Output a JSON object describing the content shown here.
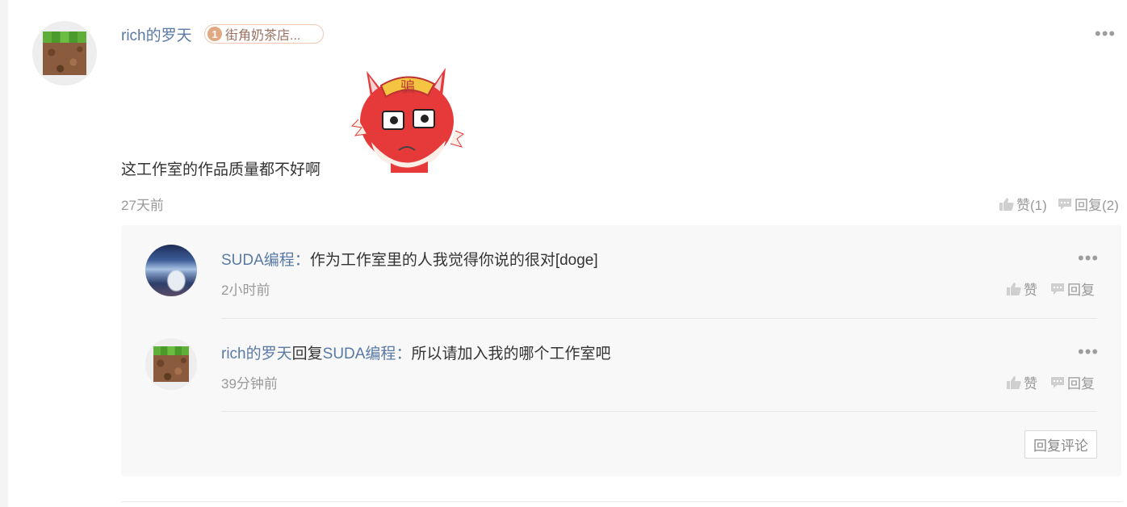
{
  "comment": {
    "username": "rich的罗天",
    "badge": {
      "level": "1",
      "text": "街角奶茶店..."
    },
    "text": "这工作室的作品质量都不好啊",
    "time": "27天前",
    "like_label": "赞(1)",
    "reply_label": "回复(2)",
    "more_icon": "more-dots-icon"
  },
  "replies": [
    {
      "username": "SUDA编程",
      "separator": "：",
      "text": "作为工作室里的人我觉得你说的很对[doge]",
      "time": "2小时前",
      "like_label": "赞",
      "reply_label": "回复"
    },
    {
      "username": "rich的罗天",
      "reply_word": "回复",
      "target": "SUDA编程",
      "separator": "：",
      "text": "所以请加入我的哪个工作室吧",
      "time": "39分钟前",
      "like_label": "赞",
      "reply_label": "回复"
    }
  ],
  "reply_comment_button": "回复评论",
  "colors": {
    "link": "#5a7aa5",
    "muted": "#999999",
    "panel": "#f8f8f8"
  }
}
